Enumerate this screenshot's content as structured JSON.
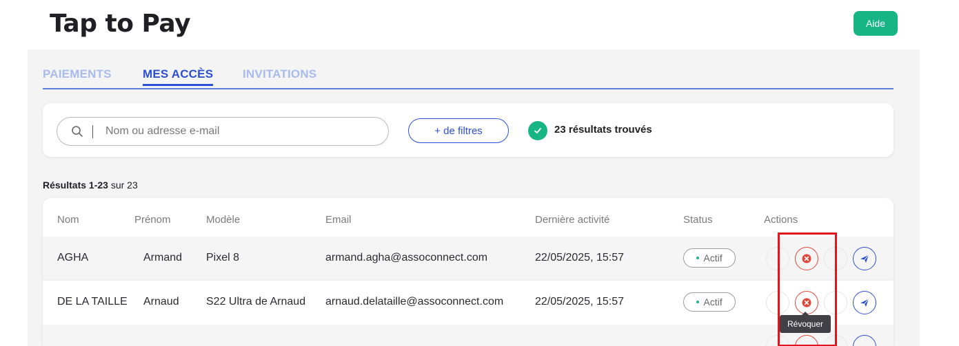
{
  "header": {
    "title": "Tap to Pay",
    "help_label": "Aide"
  },
  "tabs": [
    {
      "label": "PAIEMENTS",
      "active": false
    },
    {
      "label": "MES ACCÈS",
      "active": true
    },
    {
      "label": "INVITATIONS",
      "active": false
    }
  ],
  "filters": {
    "search_placeholder": "Nom ou adresse e-mail",
    "search_value": "",
    "more_filters_label": "+ de filtres",
    "results_found": "23 résultats trouvés"
  },
  "results": {
    "range_label": "Résultats 1-23",
    "total_label": "sur 23"
  },
  "table": {
    "columns": [
      "Nom",
      "Prénom",
      "Modèle",
      "Email",
      "Dernière activité",
      "Status",
      "Actions"
    ],
    "rows": [
      {
        "nom": "AGHA",
        "prenom": "Armand",
        "modele": "Pixel 8",
        "email": "armand.agha@assoconnect.com",
        "derniere_activite": "22/05/2025, 15:57",
        "status": "Actif"
      },
      {
        "nom": "DE LA TAILLE",
        "prenom": "Arnaud",
        "modele": "S22 Ultra de Arnaud",
        "email": "arnaud.delataille@assoconnect.com",
        "derniere_activite": "22/05/2025, 15:57",
        "status": "Actif"
      }
    ]
  },
  "tooltip": {
    "label": "Révoquer"
  },
  "icons": {
    "search": "search-icon",
    "check": "check-circle-icon",
    "unknown_action": "action-icon",
    "revoke": "revoke-x-circle-icon",
    "disabled_action": "disabled-action-icon",
    "send": "send-paper-plane-icon"
  },
  "colors": {
    "accent": "#2b4fd4",
    "accent_light": "#a9bbea",
    "success": "#17b584",
    "danger": "#e0453a",
    "highlight": "#e0141a"
  }
}
